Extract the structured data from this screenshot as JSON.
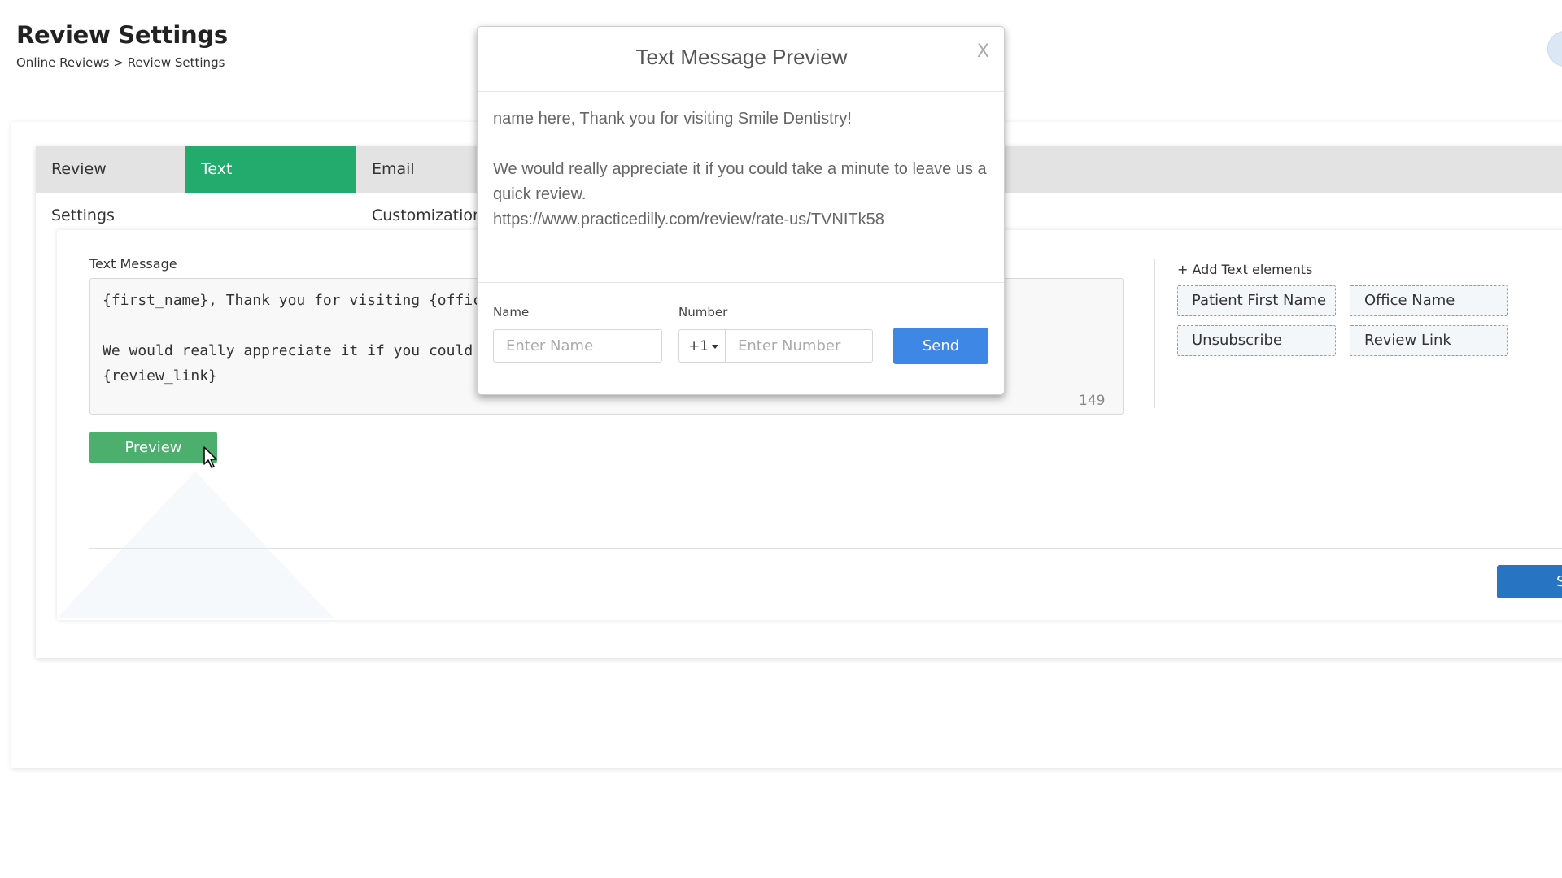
{
  "header": {
    "title": "Review Settings",
    "breadcrumb": "Online Reviews > Review Settings"
  },
  "tabs": [
    {
      "label": "Review Settings",
      "active": false
    },
    {
      "label": "Text Customization",
      "active": true
    },
    {
      "label": "Email Customization",
      "active": false
    }
  ],
  "text_message": {
    "label": "Text Message",
    "value": "{first_name}, Thank you for visiting {office_name}!\n\nWe would really appreciate it if you could take a minute to leave us a quick review.\n{review_link}",
    "char_count": "149"
  },
  "preview_button": "Preview",
  "text_elements": {
    "heading": "+ Add Text elements",
    "chips": [
      "Patient First Name",
      "Office Name",
      "Unsubscribe",
      "Review Link"
    ]
  },
  "save_button": "Save",
  "modal": {
    "title": "Text Message Preview",
    "close": "X",
    "body_line1": "name here, Thank you for visiting Smile Dentistry!",
    "body_line2": "We would really appreciate it if you could take a minute to leave us a quick review.",
    "body_line3": "https://www.practicedilly.com/review/rate-us/TVNITk58",
    "name_label": "Name",
    "name_placeholder": "Enter Name",
    "number_label": "Number",
    "country_code": "+1",
    "number_placeholder": "Enter Number",
    "send_button": "Send"
  },
  "colors": {
    "active_tab": "#22ab6d",
    "preview_button": "#4caf6d",
    "send_button": "#3f87e4",
    "save_button": "#2774c3"
  }
}
